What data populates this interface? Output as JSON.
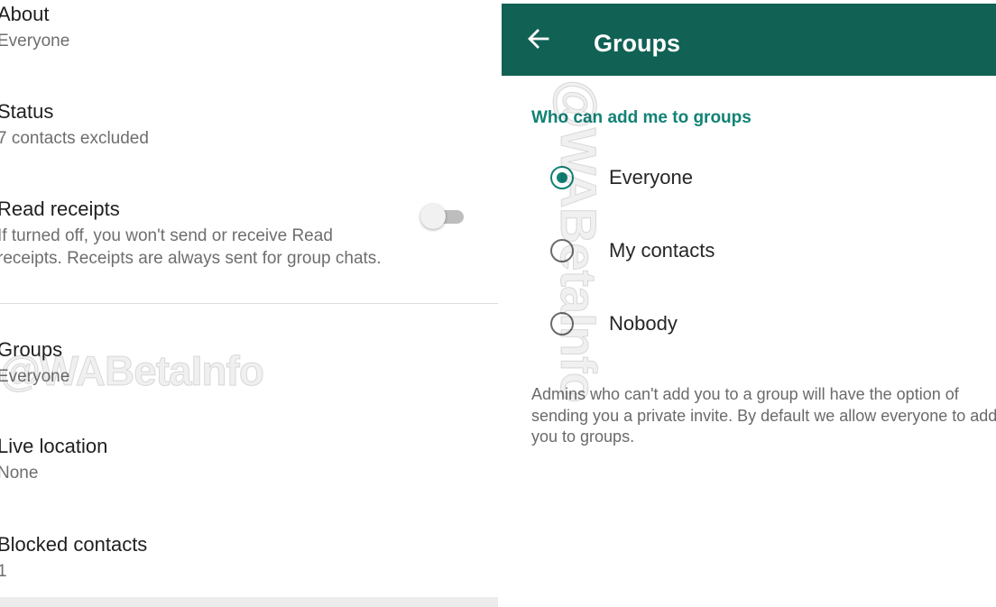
{
  "left_panel": {
    "settings": [
      {
        "title": "About",
        "subtitle": "Everyone"
      },
      {
        "title": "Status",
        "subtitle": "7 contacts excluded"
      },
      {
        "title": "Read receipts",
        "subtitle_line1": "If turned off, you won't send or receive Read",
        "subtitle_line2": "receipts. Receipts are always sent for group chats.",
        "toggle_on": false
      },
      {
        "title": "Groups",
        "subtitle": "Everyone"
      },
      {
        "title": "Live location",
        "subtitle": "None"
      },
      {
        "title": "Blocked contacts",
        "subtitle": "1"
      }
    ]
  },
  "right_panel": {
    "appbar": {
      "title": "Groups",
      "back_icon": "arrow-back-icon",
      "color": "#116155"
    },
    "section_header": "Who can add me to groups",
    "options": [
      {
        "label": "Everyone",
        "selected": true
      },
      {
        "label": "My contacts",
        "selected": false
      },
      {
        "label": "Nobody",
        "selected": false
      }
    ],
    "note": "Admins who can't add you to a group will have the option of sending you a private invite. By default we allow everyone to add you to groups."
  },
  "watermark": "@WABetaInfo",
  "colors": {
    "accent": "#128276",
    "header_text": "#118275"
  }
}
